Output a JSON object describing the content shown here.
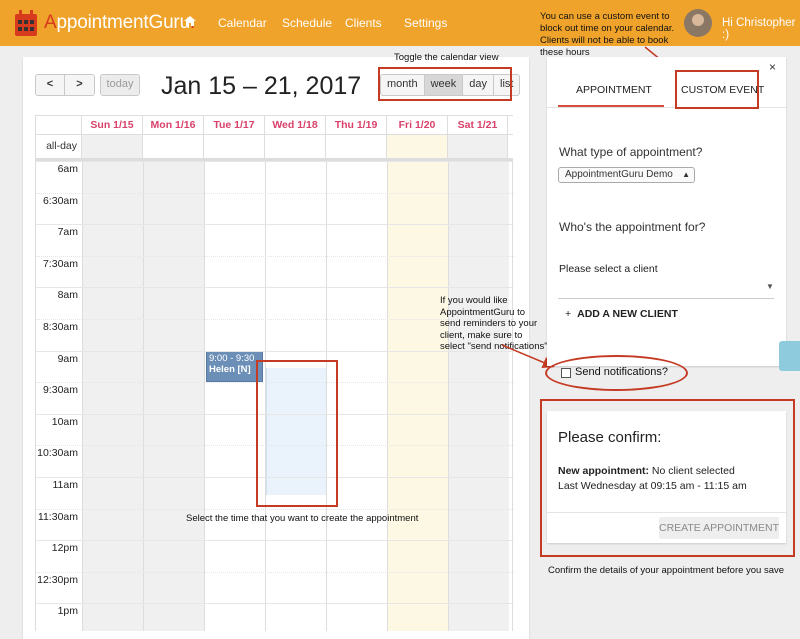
{
  "brand": {
    "pre": "A",
    "rest": "ppointmentGuru",
    "dot": "."
  },
  "nav": {
    "items": [
      "Calendar",
      "Schedule",
      "Clients",
      "Settings"
    ]
  },
  "top_note": "You can use a custom event to block out time on your calendar. Clients will not be able to book these hours",
  "user": {
    "greeting": "Hi Christopher :)"
  },
  "calendar": {
    "title": "Jan 15 – 21, 2017",
    "prev": "<",
    "next": ">",
    "today": "today",
    "views": [
      "month",
      "week",
      "day",
      "list"
    ],
    "active_view": "week",
    "days": [
      "Sun 1/15",
      "Mon 1/16",
      "Tue 1/17",
      "Wed 1/18",
      "Thu 1/19",
      "Fri 1/20",
      "Sat 1/21"
    ],
    "allday_label": "all-day",
    "times": [
      "6am",
      "6:30am",
      "7am",
      "7:30am",
      "8am",
      "8:30am",
      "9am",
      "9:30am",
      "10am",
      "10:30am",
      "11am",
      "11:30am",
      "12pm",
      "12:30pm",
      "1pm"
    ],
    "event": {
      "time": "9:00 - 9:30",
      "title": "Helen [N]"
    }
  },
  "annotations": {
    "toggle": "Toggle the calendar view",
    "reminders": "If you would like AppointmentGuru to send reminders to your client, make sure to select \"send notifications\"",
    "select_time": "Select the time that you want to create the appointment",
    "confirm": "Confirm the details of your appointment before you save"
  },
  "form": {
    "close": "×",
    "tabs": [
      "Appointment",
      "Custom Event"
    ],
    "q_type": "What type of appointment?",
    "type_value": "AppointmentGuru Demo",
    "q_for": "Who's the appointment for?",
    "client_placeholder": "Please select a client",
    "add_client": "ADD A NEW CLIENT",
    "notifications": "Send notifications?"
  },
  "confirm": {
    "title": "Please confirm:",
    "line1_label": "New appointment:",
    "line1_value": "No client selected",
    "line2": "Last Wednesday at 09:15 am - 11:15 am",
    "button": "Create Appointment"
  },
  "colors": {
    "brand_orange": "#f0a32a",
    "day_header": "#d8416a",
    "annotation_red": "#c53a23",
    "event_blue": "#6c8fb8"
  }
}
